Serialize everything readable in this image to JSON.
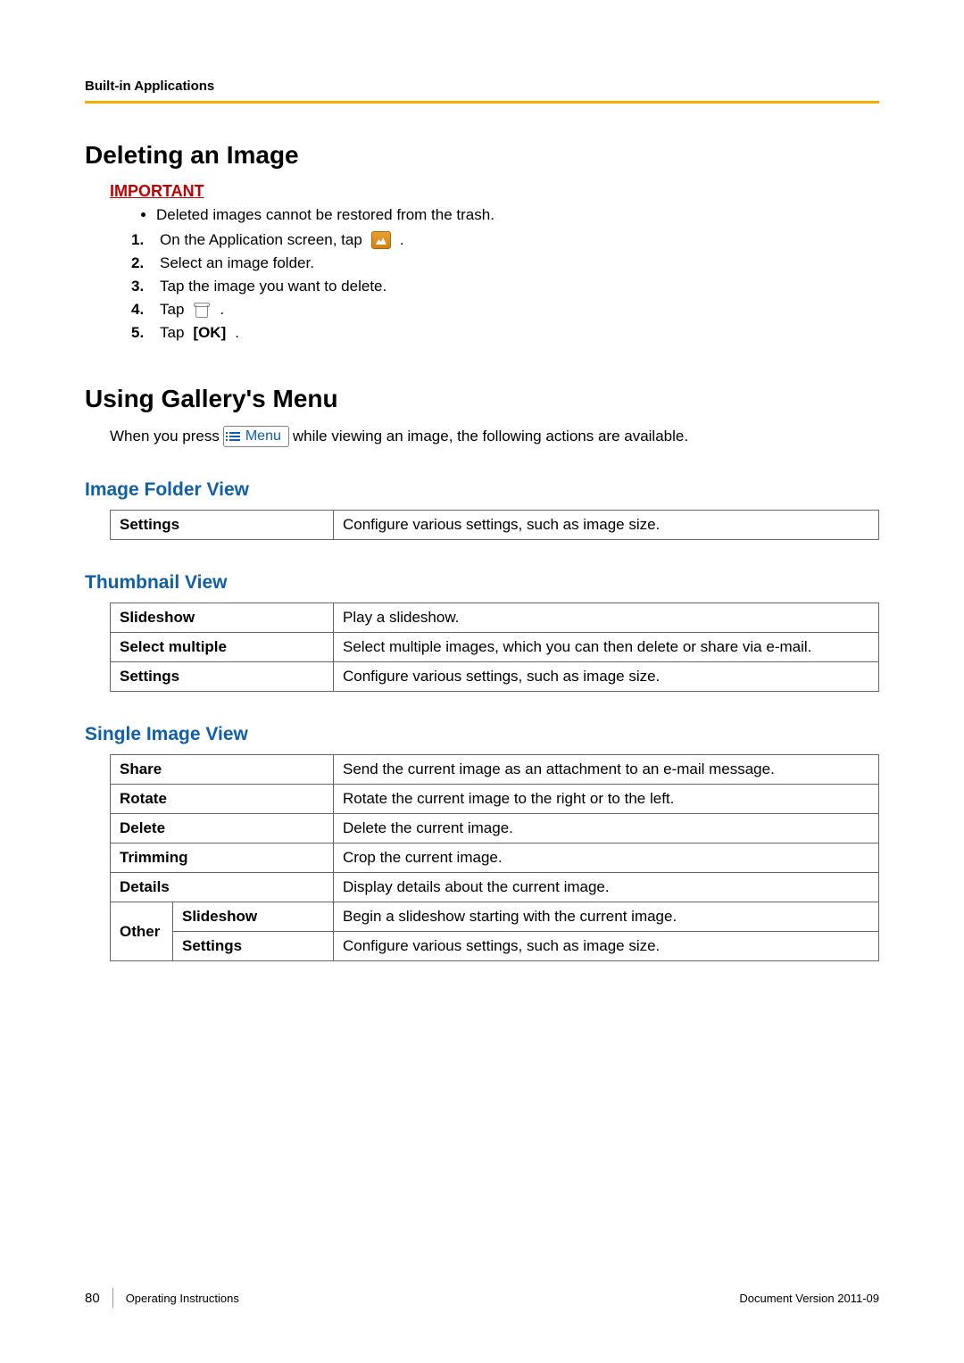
{
  "header": {
    "section": "Built-in Applications"
  },
  "section1": {
    "title": "Deleting an Image",
    "important_label": "IMPORTANT",
    "important_note": "Deleted images cannot be restored from the trash.",
    "steps": {
      "s1a": "On the Application screen, tap ",
      "s1b": " .",
      "s2": "Select an image folder.",
      "s3": "Tap the image you want to delete.",
      "s4a": "Tap ",
      "s4b": " .",
      "s5a": "Tap ",
      "s5b": "[OK]",
      "s5c": "."
    }
  },
  "section2": {
    "title": "Using Gallery's Menu",
    "intro_a": "When you press ",
    "menu_label": "Menu",
    "intro_b": " while viewing an image, the following actions are available."
  },
  "folderView": {
    "title": "Image Folder View",
    "rows": [
      {
        "label": "Settings",
        "desc": "Configure various settings, such as image size."
      }
    ]
  },
  "thumbView": {
    "title": "Thumbnail View",
    "rows": [
      {
        "label": "Slideshow",
        "desc": "Play a slideshow."
      },
      {
        "label": "Select multiple",
        "desc": "Select multiple images, which you can then delete or share via e-mail."
      },
      {
        "label": "Settings",
        "desc": "Configure various settings, such as image size."
      }
    ]
  },
  "singleView": {
    "title": "Single Image View",
    "rows": [
      {
        "label": "Share",
        "desc": "Send the current image as an attachment to an e-mail message."
      },
      {
        "label": "Rotate",
        "desc": "Rotate the current image to the right or to the left."
      },
      {
        "label": "Delete",
        "desc": "Delete the current image."
      },
      {
        "label": "Trimming",
        "desc": "Crop the current image."
      },
      {
        "label": "Details",
        "desc": "Display details about the current image."
      }
    ],
    "other": {
      "label": "Other",
      "rows": [
        {
          "label": "Slideshow",
          "desc": "Begin a slideshow starting with the current image."
        },
        {
          "label": "Settings",
          "desc": "Configure various settings, such as image size."
        }
      ]
    }
  },
  "footer": {
    "page": "80",
    "doc": "Operating Instructions",
    "version": "Document Version   2011-09"
  }
}
